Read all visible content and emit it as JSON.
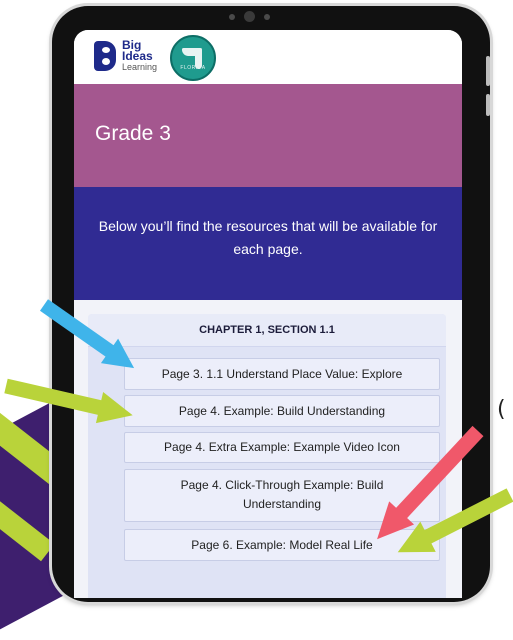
{
  "brand": {
    "logo_line1": "Big",
    "logo_line2": "Ideas",
    "logo_line3": "Learning",
    "state_badge_text": "FLORIDA"
  },
  "page": {
    "title": "Grade 3",
    "intro": "Below you’ll find the resources that will be available for each page."
  },
  "section": {
    "heading": "CHAPTER 1, SECTION 1.1",
    "items": [
      {
        "label": "Page 3. 1.1 Understand Place Value:  Explore"
      },
      {
        "label": "Page 4. Example:  Build Understanding"
      },
      {
        "label": "Page 4. Extra Example:  Example Video Icon"
      },
      {
        "label": "Page 4. Click-Through Example:  Build Understanding"
      },
      {
        "label": "Page 6. Example:  Model Real Life"
      }
    ]
  },
  "decor": {
    "side_glyph": "(",
    "colors": {
      "title_band": "#a4578f",
      "intro_band": "#302b93",
      "arrow_blue": "#3fb4ea",
      "arrow_lime": "#b9d33a",
      "arrow_red": "#f0586a"
    }
  }
}
